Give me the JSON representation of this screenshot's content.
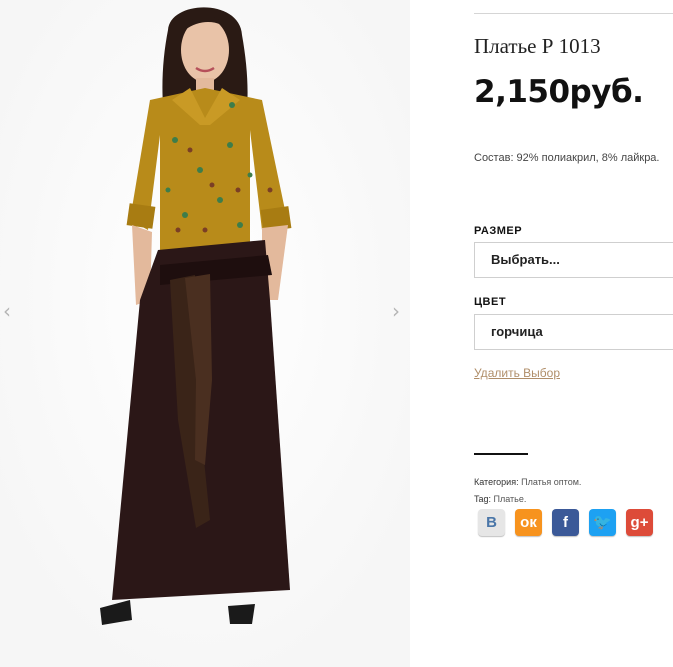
{
  "gallery": {
    "prev_arrow": "‹",
    "next_arrow": "›"
  },
  "product": {
    "title": "Платье Р 1013",
    "price": "2,150руб.",
    "composition": "Состав: 92% полиакрил, 8% лайкра."
  },
  "options": {
    "size_label": "РАЗМЕР",
    "size_value": "Выбрать...",
    "color_label": "ЦВЕТ",
    "color_value": "горчица",
    "reset_label": "Удалить Выбор"
  },
  "meta": {
    "category_prefix": "Категория:",
    "category_value": "Платья оптом.",
    "tag_prefix": "Tag:",
    "tag_value": "Платье."
  },
  "socials": [
    {
      "name": "vkontakte",
      "glyph": "В",
      "color": "#e6e6e6",
      "text_color": "#4a76a8"
    },
    {
      "name": "odnoklassniki",
      "glyph": "ок",
      "color": "#f7931e",
      "text_color": "#ffffff"
    },
    {
      "name": "facebook",
      "glyph": "f",
      "color": "#3b5998",
      "text_color": "#ffffff"
    },
    {
      "name": "twitter",
      "glyph": "🐦",
      "color": "#1da1f2",
      "text_color": "#ffffff"
    },
    {
      "name": "google-plus",
      "glyph": "g+",
      "color": "#dd4b39",
      "text_color": "#ffffff"
    }
  ],
  "colors": {
    "shirt": "#b88b1a",
    "skirt": "#2b1717",
    "link": "#b08e69"
  }
}
